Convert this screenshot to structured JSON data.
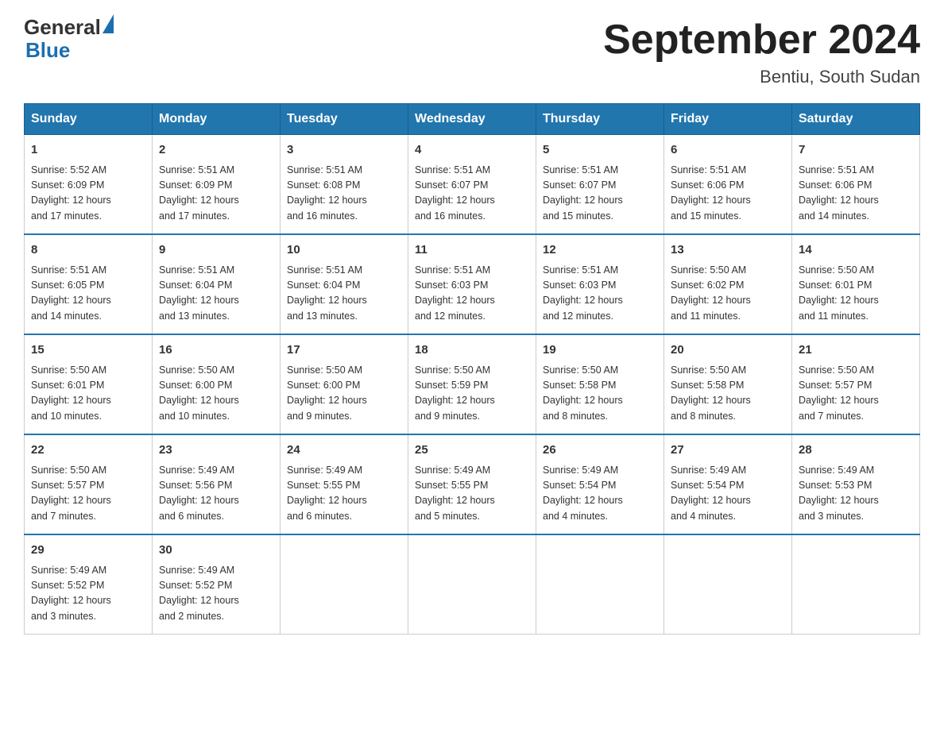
{
  "header": {
    "logo_text": "General",
    "logo_sub": "Blue",
    "title": "September 2024",
    "location": "Bentiu, South Sudan"
  },
  "days_of_week": [
    "Sunday",
    "Monday",
    "Tuesday",
    "Wednesday",
    "Thursday",
    "Friday",
    "Saturday"
  ],
  "weeks": [
    [
      {
        "day": "1",
        "sunrise": "5:52 AM",
        "sunset": "6:09 PM",
        "daylight": "12 hours and 17 minutes."
      },
      {
        "day": "2",
        "sunrise": "5:51 AM",
        "sunset": "6:09 PM",
        "daylight": "12 hours and 17 minutes."
      },
      {
        "day": "3",
        "sunrise": "5:51 AM",
        "sunset": "6:08 PM",
        "daylight": "12 hours and 16 minutes."
      },
      {
        "day": "4",
        "sunrise": "5:51 AM",
        "sunset": "6:07 PM",
        "daylight": "12 hours and 16 minutes."
      },
      {
        "day": "5",
        "sunrise": "5:51 AM",
        "sunset": "6:07 PM",
        "daylight": "12 hours and 15 minutes."
      },
      {
        "day": "6",
        "sunrise": "5:51 AM",
        "sunset": "6:06 PM",
        "daylight": "12 hours and 15 minutes."
      },
      {
        "day": "7",
        "sunrise": "5:51 AM",
        "sunset": "6:06 PM",
        "daylight": "12 hours and 14 minutes."
      }
    ],
    [
      {
        "day": "8",
        "sunrise": "5:51 AM",
        "sunset": "6:05 PM",
        "daylight": "12 hours and 14 minutes."
      },
      {
        "day": "9",
        "sunrise": "5:51 AM",
        "sunset": "6:04 PM",
        "daylight": "12 hours and 13 minutes."
      },
      {
        "day": "10",
        "sunrise": "5:51 AM",
        "sunset": "6:04 PM",
        "daylight": "12 hours and 13 minutes."
      },
      {
        "day": "11",
        "sunrise": "5:51 AM",
        "sunset": "6:03 PM",
        "daylight": "12 hours and 12 minutes."
      },
      {
        "day": "12",
        "sunrise": "5:51 AM",
        "sunset": "6:03 PM",
        "daylight": "12 hours and 12 minutes."
      },
      {
        "day": "13",
        "sunrise": "5:50 AM",
        "sunset": "6:02 PM",
        "daylight": "12 hours and 11 minutes."
      },
      {
        "day": "14",
        "sunrise": "5:50 AM",
        "sunset": "6:01 PM",
        "daylight": "12 hours and 11 minutes."
      }
    ],
    [
      {
        "day": "15",
        "sunrise": "5:50 AM",
        "sunset": "6:01 PM",
        "daylight": "12 hours and 10 minutes."
      },
      {
        "day": "16",
        "sunrise": "5:50 AM",
        "sunset": "6:00 PM",
        "daylight": "12 hours and 10 minutes."
      },
      {
        "day": "17",
        "sunrise": "5:50 AM",
        "sunset": "6:00 PM",
        "daylight": "12 hours and 9 minutes."
      },
      {
        "day": "18",
        "sunrise": "5:50 AM",
        "sunset": "5:59 PM",
        "daylight": "12 hours and 9 minutes."
      },
      {
        "day": "19",
        "sunrise": "5:50 AM",
        "sunset": "5:58 PM",
        "daylight": "12 hours and 8 minutes."
      },
      {
        "day": "20",
        "sunrise": "5:50 AM",
        "sunset": "5:58 PM",
        "daylight": "12 hours and 8 minutes."
      },
      {
        "day": "21",
        "sunrise": "5:50 AM",
        "sunset": "5:57 PM",
        "daylight": "12 hours and 7 minutes."
      }
    ],
    [
      {
        "day": "22",
        "sunrise": "5:50 AM",
        "sunset": "5:57 PM",
        "daylight": "12 hours and 7 minutes."
      },
      {
        "day": "23",
        "sunrise": "5:49 AM",
        "sunset": "5:56 PM",
        "daylight": "12 hours and 6 minutes."
      },
      {
        "day": "24",
        "sunrise": "5:49 AM",
        "sunset": "5:55 PM",
        "daylight": "12 hours and 6 minutes."
      },
      {
        "day": "25",
        "sunrise": "5:49 AM",
        "sunset": "5:55 PM",
        "daylight": "12 hours and 5 minutes."
      },
      {
        "day": "26",
        "sunrise": "5:49 AM",
        "sunset": "5:54 PM",
        "daylight": "12 hours and 4 minutes."
      },
      {
        "day": "27",
        "sunrise": "5:49 AM",
        "sunset": "5:54 PM",
        "daylight": "12 hours and 4 minutes."
      },
      {
        "day": "28",
        "sunrise": "5:49 AM",
        "sunset": "5:53 PM",
        "daylight": "12 hours and 3 minutes."
      }
    ],
    [
      {
        "day": "29",
        "sunrise": "5:49 AM",
        "sunset": "5:52 PM",
        "daylight": "12 hours and 3 minutes."
      },
      {
        "day": "30",
        "sunrise": "5:49 AM",
        "sunset": "5:52 PM",
        "daylight": "12 hours and 2 minutes."
      },
      null,
      null,
      null,
      null,
      null
    ]
  ],
  "labels": {
    "sunrise": "Sunrise:",
    "sunset": "Sunset:",
    "daylight": "Daylight:"
  }
}
